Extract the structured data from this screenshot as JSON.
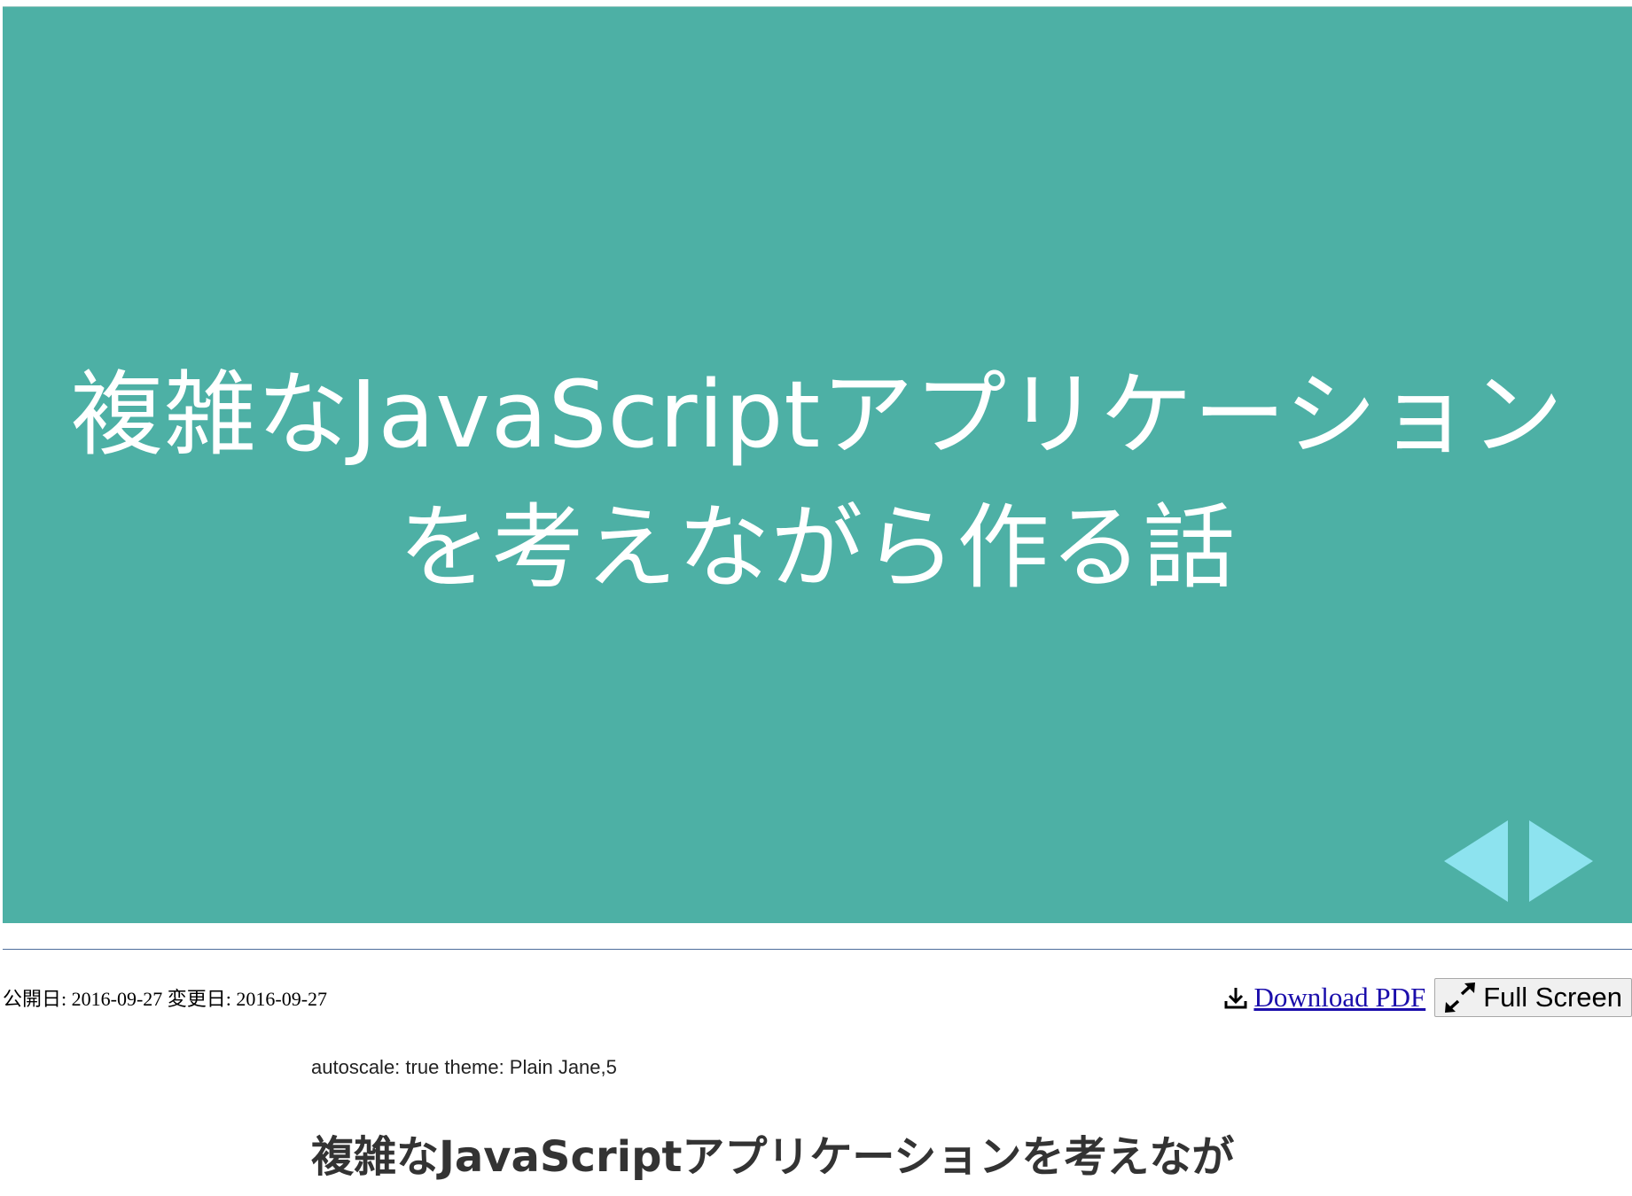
{
  "slide": {
    "title_line1": "複雑なJavaScriptアプリケーション",
    "title_line2": "を考えながら作る話",
    "background_color": "#4db0a5",
    "arrow_color": "#8de3ef",
    "prev_icon": "triangle-left-icon",
    "next_icon": "triangle-right-icon"
  },
  "meta": {
    "dates": "公開日: 2016-09-27 変更日: 2016-09-27"
  },
  "actions": {
    "download_label": "Download PDF",
    "download_icon": "download-icon",
    "fullscreen_label": "Full Screen",
    "fullscreen_icon": "expand-icon",
    "link_color": "#1a0dab"
  },
  "document": {
    "settings": "autoscale: true theme: Plain Jane,5",
    "heading": "複雑なJavaScriptアプリケーションを考えなが"
  }
}
